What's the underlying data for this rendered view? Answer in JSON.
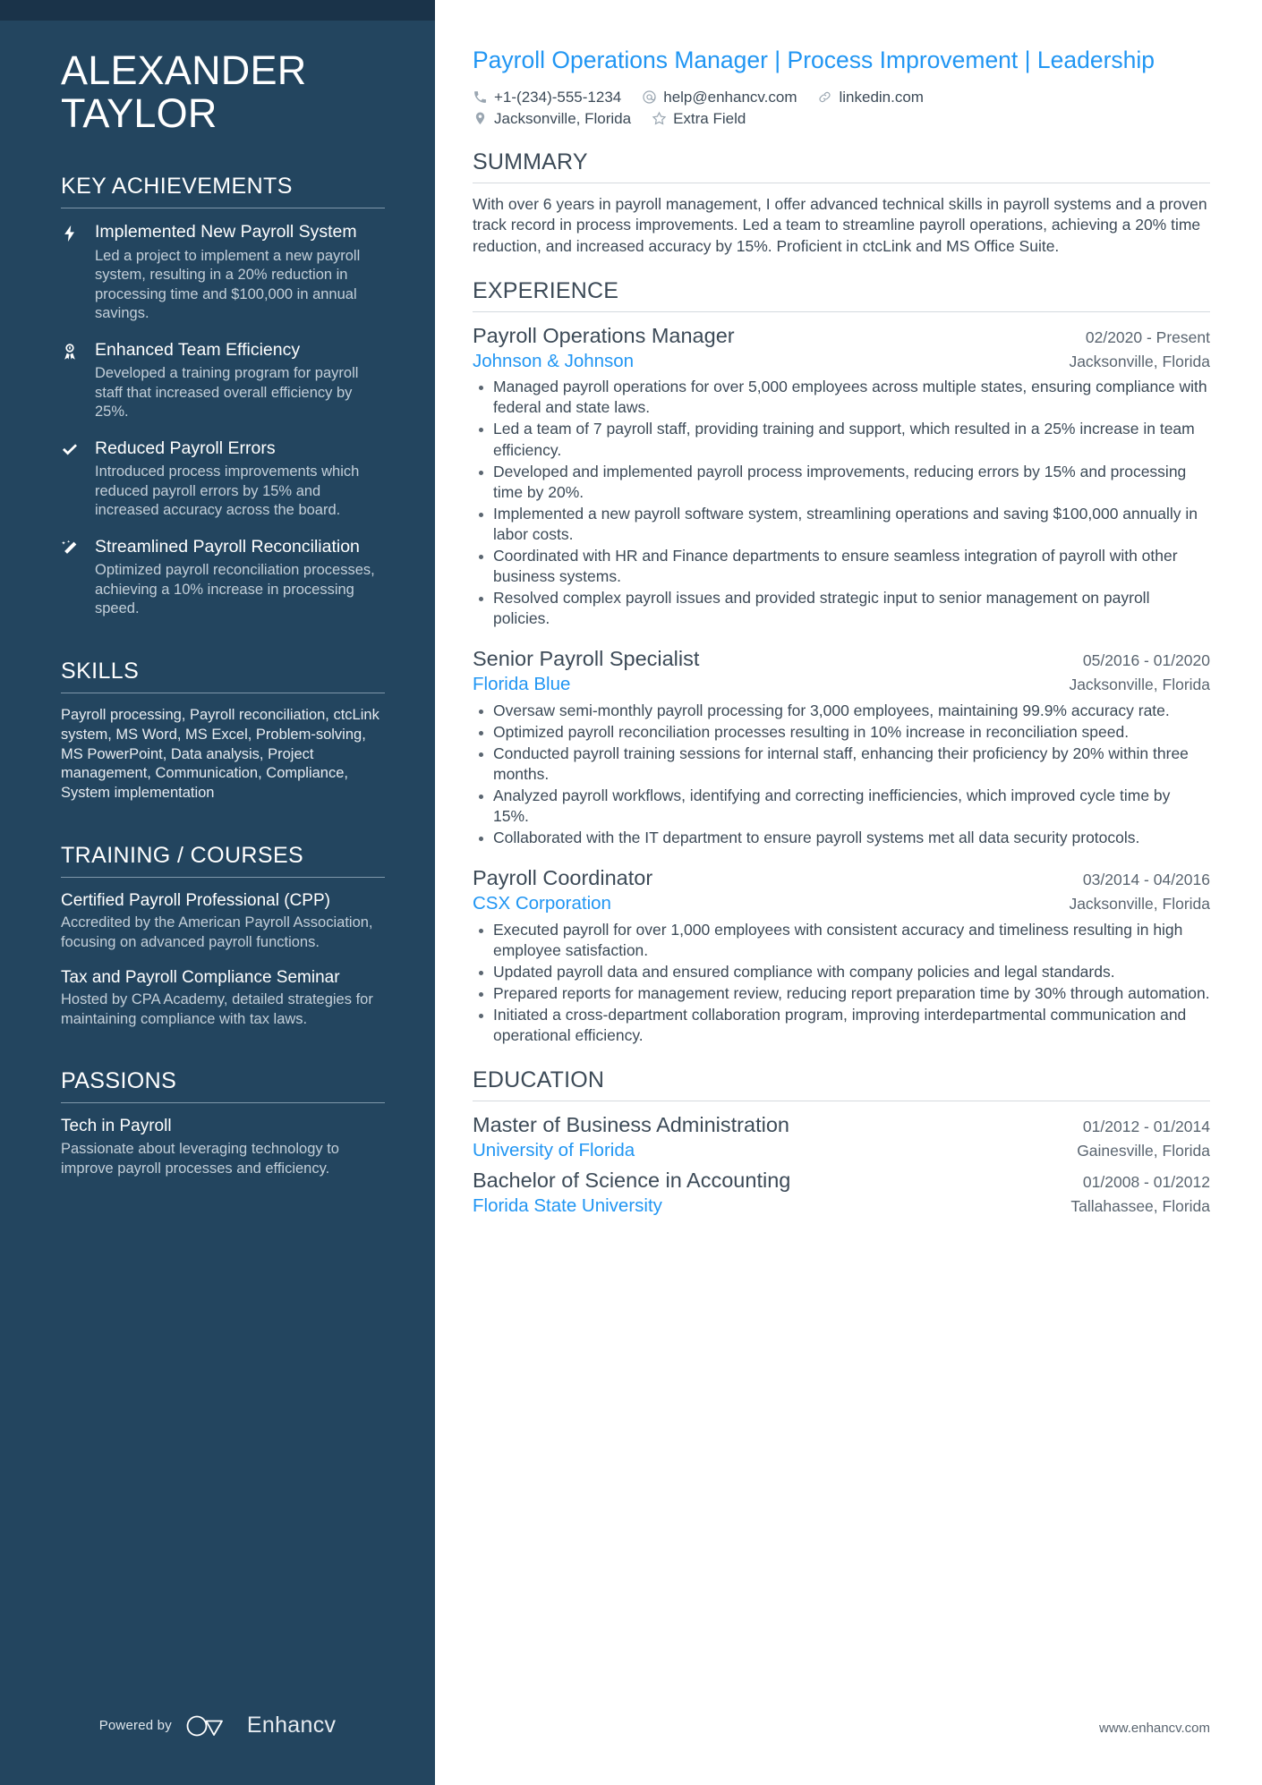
{
  "colors": {
    "sidebar_bg": "#23455f",
    "accent_blue": "#2196f3",
    "text_dark": "#3c4a57",
    "muted": "#5a6570"
  },
  "sidebar": {
    "name_line1": "ALEXANDER",
    "name_line2": "TAYLOR",
    "sections": {
      "achievements_title": "KEY ACHIEVEMENTS",
      "skills_title": "SKILLS",
      "training_title": "TRAINING / COURSES",
      "passions_title": "PASSIONS"
    },
    "achievements": [
      {
        "icon": "lightning-bolt-icon",
        "title": "Implemented New Payroll System",
        "desc": "Led a project to implement a new payroll system, resulting in a 20% reduction in processing time and $100,000 in annual savings."
      },
      {
        "icon": "award-ribbon-icon",
        "title": "Enhanced Team Efficiency",
        "desc": "Developed a training program for payroll staff that increased overall efficiency by 25%."
      },
      {
        "icon": "check-mark-icon",
        "title": "Reduced Payroll Errors",
        "desc": "Introduced process improvements which reduced payroll errors by 15% and increased accuracy across the board."
      },
      {
        "icon": "magic-wand-icon",
        "title": "Streamlined Payroll Reconciliation",
        "desc": "Optimized payroll reconciliation processes, achieving a 10% increase in processing speed."
      }
    ],
    "skills_text": "Payroll processing, Payroll reconciliation, ctcLink system, MS Word, MS Excel, Problem-solving, MS PowerPoint, Data analysis, Project management, Communication, Compliance, System implementation",
    "courses": [
      {
        "title": "Certified Payroll Professional (CPP)",
        "desc": "Accredited by the American Payroll Association, focusing on advanced payroll functions."
      },
      {
        "title": "Tax and Payroll Compliance Seminar",
        "desc": "Hosted by CPA Academy, detailed strategies for maintaining compliance with tax laws."
      }
    ],
    "passions": [
      {
        "title": "Tech in Payroll",
        "desc": "Passionate about leveraging technology to improve payroll processes and efficiency."
      }
    ],
    "footer": {
      "powered_by": "Powered by",
      "brand": "Enhancv"
    }
  },
  "main": {
    "headline": "Payroll Operations Manager | Process Improvement | Leadership",
    "contact": {
      "phone": "+1-(234)-555-1234",
      "email": "help@enhancv.com",
      "linkedin": "linkedin.com",
      "location": "Jacksonville, Florida",
      "extra": "Extra Field"
    },
    "sections": {
      "summary_title": "SUMMARY",
      "experience_title": "EXPERIENCE",
      "education_title": "EDUCATION"
    },
    "summary": "With over 6 years in payroll management, I offer advanced technical skills in payroll systems and a proven track record in process improvements. Led a team to streamline payroll operations, achieving a 20% time reduction, and increased accuracy by 15%. Proficient in ctcLink and MS Office Suite.",
    "experience": [
      {
        "title": "Payroll Operations Manager",
        "dates": "02/2020 - Present",
        "org": "Johnson & Johnson",
        "location": "Jacksonville, Florida",
        "bullets": [
          "Managed payroll operations for over 5,000 employees across multiple states, ensuring compliance with federal and state laws.",
          "Led a team of 7 payroll staff, providing training and support, which resulted in a 25% increase in team efficiency.",
          "Developed and implemented payroll process improvements, reducing errors by 15% and processing time by 20%.",
          "Implemented a new payroll software system, streamlining operations and saving $100,000 annually in labor costs.",
          "Coordinated with HR and Finance departments to ensure seamless integration of payroll with other business systems.",
          "Resolved complex payroll issues and provided strategic input to senior management on payroll policies."
        ]
      },
      {
        "title": "Senior Payroll Specialist",
        "dates": "05/2016 - 01/2020",
        "org": "Florida Blue",
        "location": "Jacksonville, Florida",
        "bullets": [
          "Oversaw semi-monthly payroll processing for 3,000 employees, maintaining 99.9% accuracy rate.",
          "Optimized payroll reconciliation processes resulting in 10% increase in reconciliation speed.",
          "Conducted payroll training sessions for internal staff, enhancing their proficiency by 20% within three months.",
          "Analyzed payroll workflows, identifying and correcting inefficiencies, which improved cycle time by 15%.",
          "Collaborated with the IT department to ensure payroll systems met all data security protocols."
        ]
      },
      {
        "title": "Payroll Coordinator",
        "dates": "03/2014 - 04/2016",
        "org": "CSX Corporation",
        "location": "Jacksonville, Florida",
        "bullets": [
          "Executed payroll for over 1,000 employees with consistent accuracy and timeliness resulting in high employee satisfaction.",
          "Updated payroll data and ensured compliance with company policies and legal standards.",
          "Prepared reports for management review, reducing report preparation time by 30% through automation.",
          "Initiated a cross-department collaboration program, improving interdepartmental communication and operational efficiency."
        ]
      }
    ],
    "education": [
      {
        "title": "Master of Business Administration",
        "dates": "01/2012 - 01/2014",
        "org": "University of Florida",
        "location": "Gainesville, Florida"
      },
      {
        "title": "Bachelor of Science in Accounting",
        "dates": "01/2008 - 01/2012",
        "org": "Florida State University",
        "location": "Tallahassee, Florida"
      }
    ],
    "footer_url": "www.enhancv.com"
  }
}
